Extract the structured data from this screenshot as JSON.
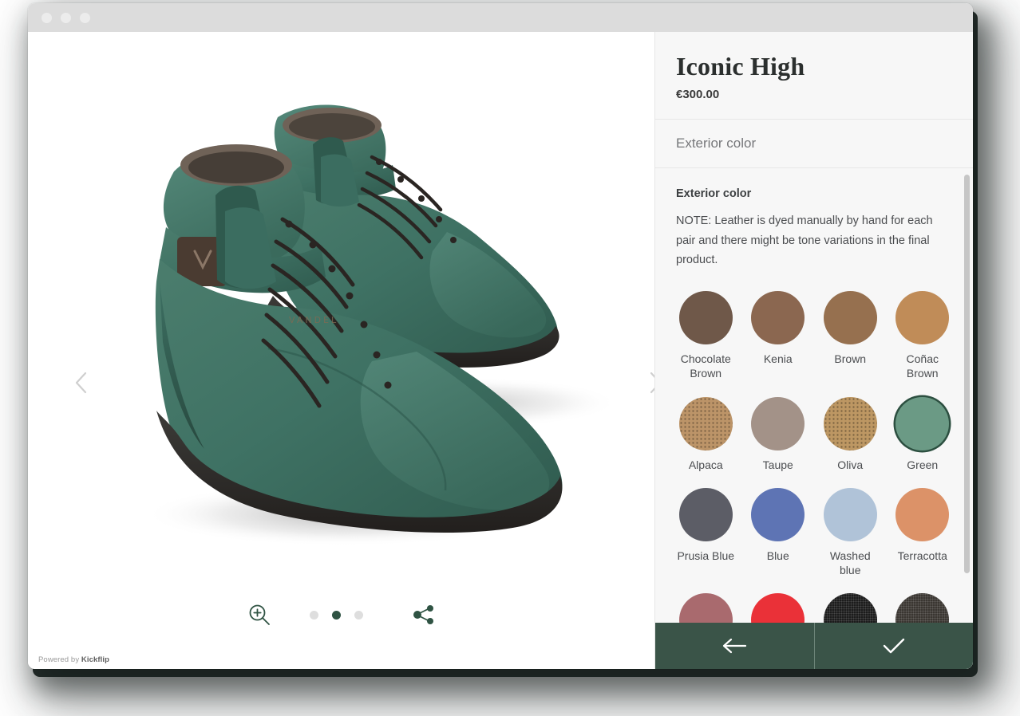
{
  "window": {
    "traffic_lights": [
      "close",
      "minimize",
      "maximize"
    ]
  },
  "viewer": {
    "prev_icon": "chevron-left-icon",
    "next_icon": "chevron-right-icon",
    "zoom_icon": "magnifier-plus-icon",
    "share_icon": "share-icon",
    "dots": [
      {
        "active": false
      },
      {
        "active": true
      },
      {
        "active": false
      }
    ],
    "powered_prefix": "Powered by ",
    "powered_brand": "Kickflip",
    "accent_color": "#2f5343"
  },
  "panel": {
    "product_title": "Iconic High",
    "product_price": "€300.00",
    "step_label": "Exterior color",
    "group_title": "Exterior color",
    "group_note": "NOTE: Leather is dyed manually by hand for each pair and there might be tone variations in the final product.",
    "swatches": [
      {
        "label": "Chocolate Brown",
        "color": "#6f5849",
        "selected": false,
        "texture": "none"
      },
      {
        "label": "Kenia",
        "color": "#8b6750",
        "selected": false,
        "texture": "none"
      },
      {
        "label": "Brown",
        "color": "#96704f",
        "selected": false,
        "texture": "none"
      },
      {
        "label": "Coñac Brown",
        "color": "#c08c58",
        "selected": false,
        "texture": "none"
      },
      {
        "label": "Alpaca",
        "color": "#bc9468",
        "selected": false,
        "texture": "dots"
      },
      {
        "label": "Taupe",
        "color": "#a39288",
        "selected": false,
        "texture": "none"
      },
      {
        "label": "Oliva",
        "color": "#bd9763",
        "selected": false,
        "texture": "dots"
      },
      {
        "label": "Green",
        "color": "#6b9a85",
        "selected": true,
        "texture": "none"
      },
      {
        "label": "Prusia Blue",
        "color": "#5c5d66",
        "selected": false,
        "texture": "none"
      },
      {
        "label": "Blue",
        "color": "#5e74b4",
        "selected": false,
        "texture": "none"
      },
      {
        "label": "Washed blue",
        "color": "#b0c3d8",
        "selected": false,
        "texture": "none"
      },
      {
        "label": "Terracotta",
        "color": "#dc9268",
        "selected": false,
        "texture": "none"
      },
      {
        "label": "",
        "color": "#a96a6e",
        "selected": false,
        "texture": "none"
      },
      {
        "label": "",
        "color": "#ea3138",
        "selected": false,
        "texture": "none"
      },
      {
        "label": "",
        "color": "#1c1c1c",
        "selected": false,
        "texture": "fine"
      },
      {
        "label": "",
        "color": "#3a3631",
        "selected": false,
        "texture": "fine"
      }
    ],
    "actions": {
      "back_icon": "arrow-left-icon",
      "confirm_icon": "check-icon",
      "bar_color": "#3a5448"
    },
    "scroll": {
      "thumb_top": 0,
      "thumb_height": 500
    }
  }
}
